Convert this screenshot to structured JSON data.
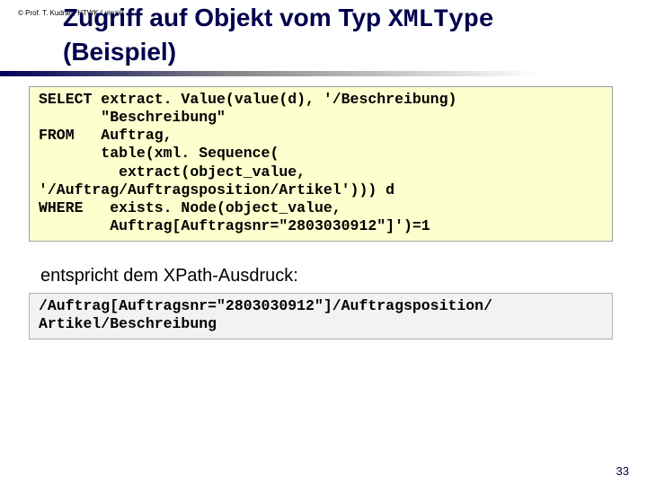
{
  "copyright": "©  Prof. T. Kudraß, HTWK Leipzig",
  "title_pre": "Zugriff auf Objekt vom Typ ",
  "title_mono": "XMLType",
  "title_post": "\n(Beispiel)",
  "sql_code": "SELECT extract. Value(value(d), '/Beschreibung)\n       \"Beschreibung\"\nFROM   Auftrag,\n       table(xml. Sequence(\n         extract(object_value,\n'/Auftrag/Auftragsposition/Artikel'))) d\nWHERE   exists. Node(object_value,\n        Auftrag[Auftragsnr=\"2803030912\"]')=1",
  "subtitle": "entspricht dem XPath-Ausdruck:",
  "xpath_code": "/Auftrag[Auftragsnr=\"2803030912\"]/Auftragsposition/\nArtikel/Beschreibung",
  "page_number": "33"
}
